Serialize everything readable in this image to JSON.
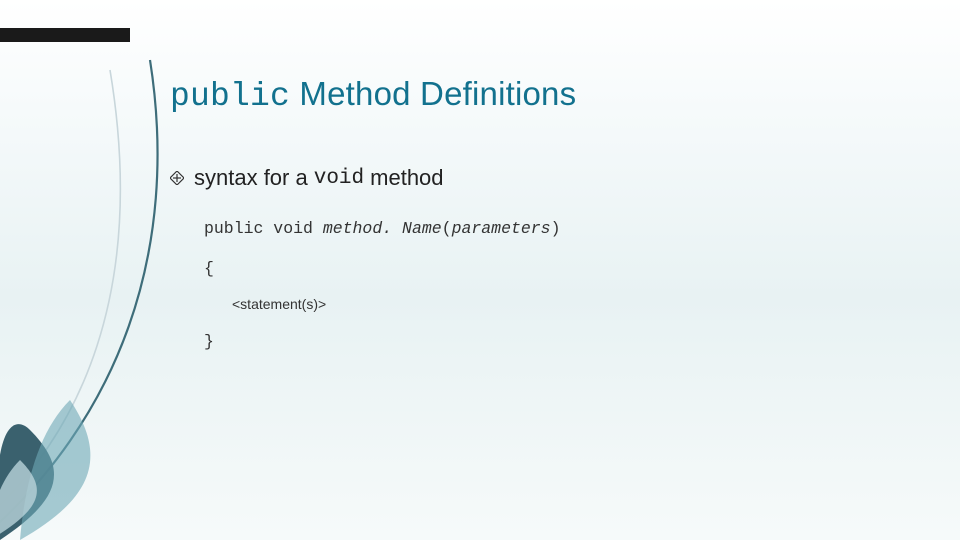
{
  "title": {
    "mono": "public",
    "rest": " Method Definitions"
  },
  "bullet": {
    "pre": "syntax for a ",
    "mono": "void",
    "post": " method"
  },
  "code": {
    "sig_pre": "public void ",
    "sig_name": "method. Name",
    "sig_paren_open": "(",
    "sig_params": "parameters",
    "sig_paren_close": ")",
    "brace_open": "{",
    "stmt": "<statement(s)>",
    "brace_close": "}"
  }
}
